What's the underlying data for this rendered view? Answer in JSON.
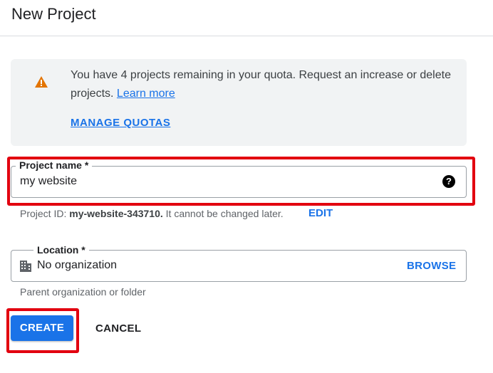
{
  "header": {
    "title": "New Project"
  },
  "banner": {
    "icon": "warning-icon",
    "message": "You have 4 projects remaining in your quota. Request an increase or delete projects.",
    "learn_more_label": "Learn more",
    "manage_quotas_label": "MANAGE QUOTAS"
  },
  "project_name": {
    "label": "Project name *",
    "value": "my website",
    "help_icon": "help-icon"
  },
  "project_id": {
    "prefix": "Project ID:",
    "id": "my-website-343710.",
    "suffix": "It cannot be changed later.",
    "edit_label": "EDIT"
  },
  "location": {
    "label": "Location *",
    "value": "No organization",
    "icon": "building-icon",
    "browse_label": "BROWSE",
    "hint": "Parent organization or folder"
  },
  "actions": {
    "create_label": "CREATE",
    "cancel_label": "CANCEL"
  },
  "colors": {
    "accent": "#1a73e8",
    "highlight": "#e2000f",
    "warning": "#e37400",
    "banner_bg": "#f1f3f4"
  }
}
